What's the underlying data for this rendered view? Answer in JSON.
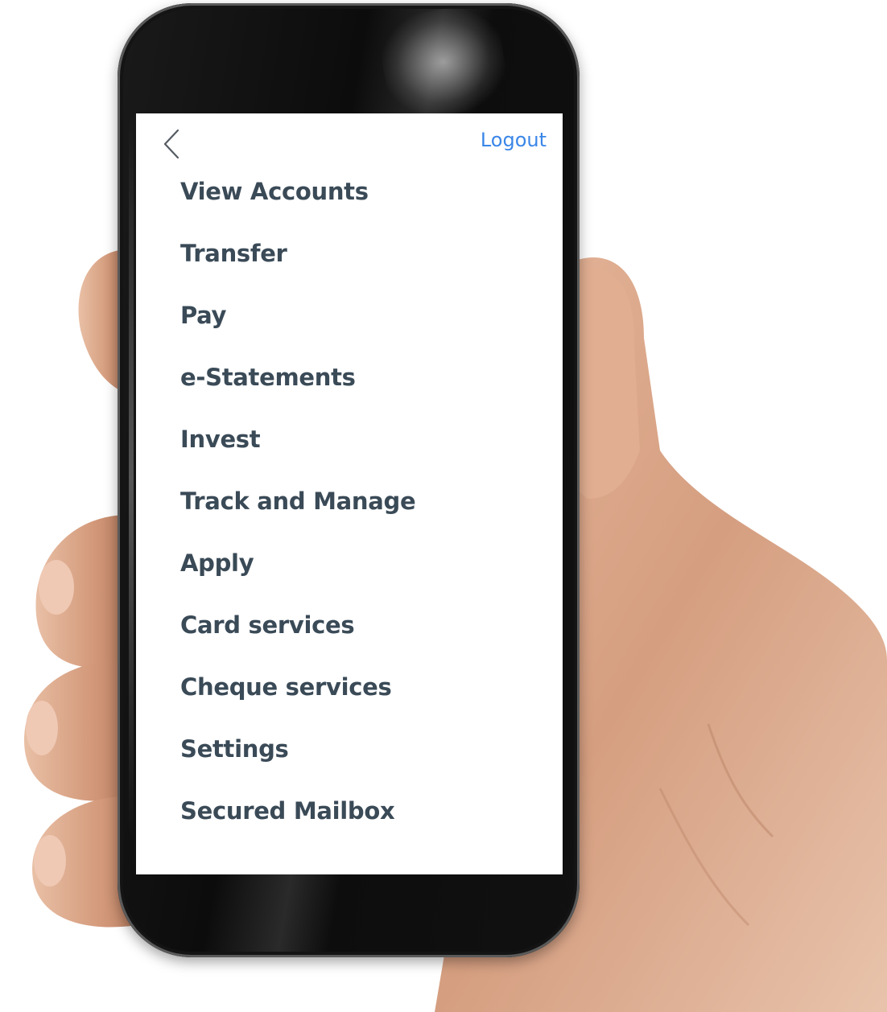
{
  "header": {
    "back_icon": "chevron-left-icon",
    "logout_label": "Logout"
  },
  "menu": {
    "items": [
      {
        "label": "View Accounts"
      },
      {
        "label": "Transfer"
      },
      {
        "label": "Pay"
      },
      {
        "label": "e-Statements"
      },
      {
        "label": "Invest"
      },
      {
        "label": "Track and Manage"
      },
      {
        "label": "Apply"
      },
      {
        "label": "Card services"
      },
      {
        "label": "Cheque services"
      },
      {
        "label": "Settings"
      },
      {
        "label": "Secured Mailbox"
      }
    ]
  },
  "colors": {
    "accent": "#3a86e8",
    "menu_text": "#3a4a57",
    "screen_bg": "#ffffff",
    "phone_body": "#111111",
    "skin": "#d9a184"
  }
}
